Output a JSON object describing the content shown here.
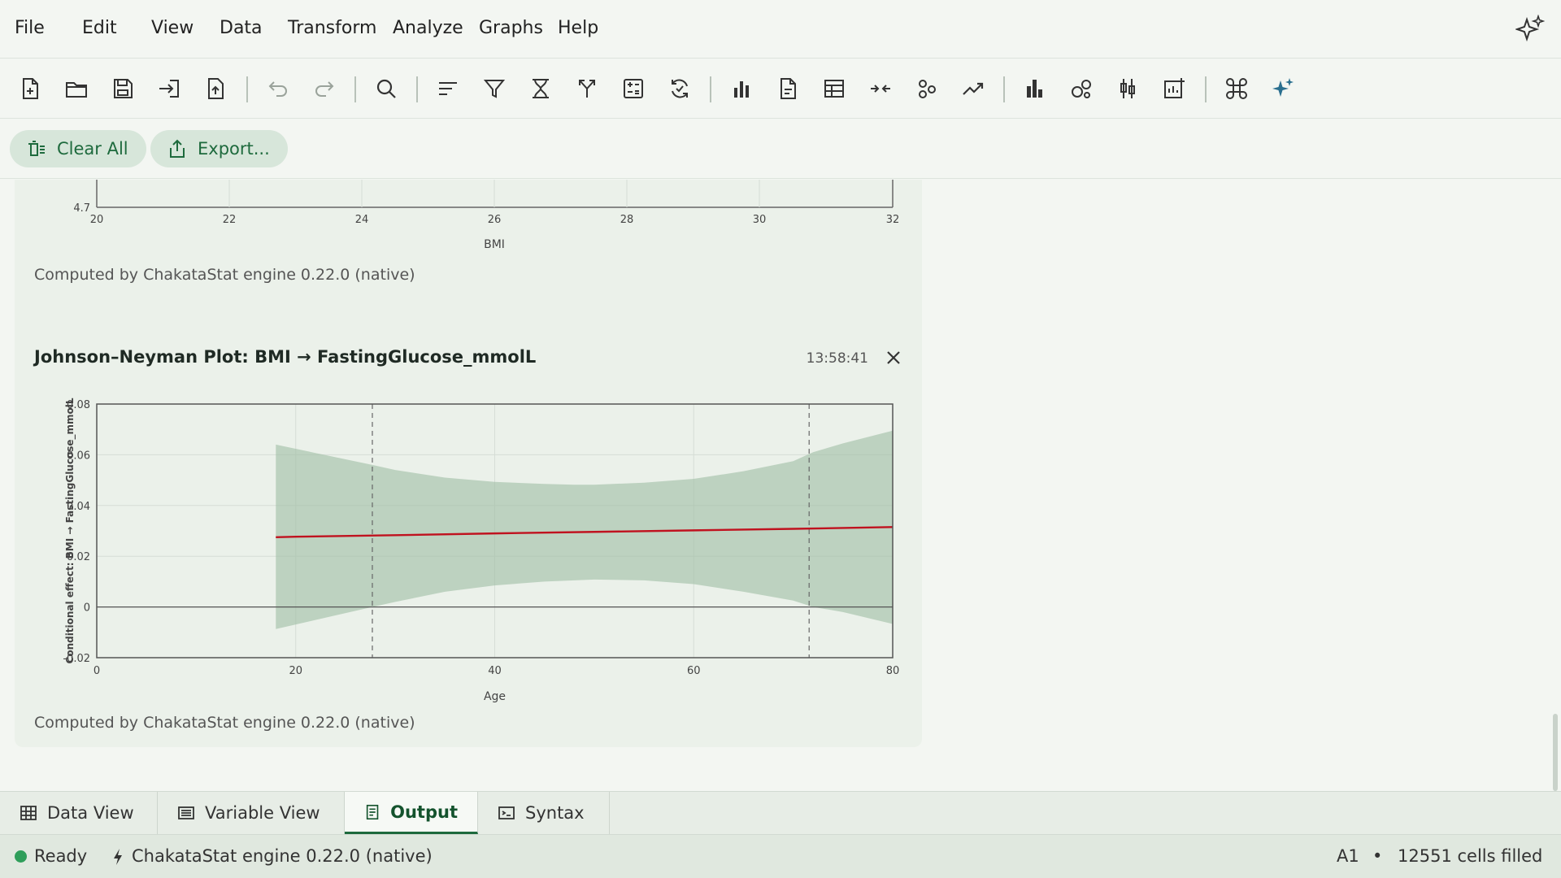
{
  "menu": {
    "items": [
      "File",
      "Edit",
      "View",
      "Data",
      "Transform",
      "Analyze",
      "Graphs",
      "Help"
    ]
  },
  "toolbar": {
    "icons": [
      "new-file-icon",
      "open-folder-icon",
      "save-icon",
      "import-icon",
      "export-file-icon",
      "undo-icon",
      "redo-icon",
      "search-icon",
      "sort-icon",
      "filter-icon",
      "select-cases-icon",
      "split-file-icon",
      "compute-icon",
      "recode-icon",
      "bar-chart-icon",
      "report-icon",
      "table-icon",
      "merge-icon",
      "scatter-icon",
      "trend-icon",
      "histogram-icon",
      "bubble-chart-icon",
      "boxplot-icon",
      "add-chart-icon",
      "command-icon",
      "ai-sparkle-icon"
    ]
  },
  "actions": {
    "clear_all": "Clear All",
    "export": "Export..."
  },
  "card1": {
    "y_tick": "4.7",
    "x_ticks": [
      "20",
      "22",
      "24",
      "26",
      "28",
      "30",
      "32"
    ],
    "x_label": "BMI",
    "footer": "Computed by ChakataStat engine 0.22.0 (native)"
  },
  "card2": {
    "title": "Johnson–Neyman Plot: BMI → FastingGlucose_mmolL",
    "timestamp": "13:58:41",
    "footer": "Computed by ChakataStat engine 0.22.0 (native)"
  },
  "chart_data": {
    "type": "line",
    "title": "Johnson–Neyman Plot: BMI → FastingGlucose_mmolL",
    "xlabel": "Age",
    "ylabel": "Conditional effect: BMI → FastingGlucose_mmolL",
    "xlim": [
      0,
      80
    ],
    "ylim": [
      -0.02,
      0.08
    ],
    "x_ticks": [
      0,
      20,
      40,
      60,
      80
    ],
    "y_ticks": [
      "-0.02",
      "0",
      "0.02",
      "0.04",
      "0.06",
      "0.08"
    ],
    "series": [
      {
        "x": [
          18,
          20,
          30,
          40,
          50,
          60,
          70,
          80
        ],
        "y": [
          0.0275,
          0.0277,
          0.0283,
          0.029,
          0.0296,
          0.0302,
          0.0308,
          0.0315
        ],
        "color": "#c0121f"
      }
    ],
    "confidence_band": {
      "x": [
        18,
        27.7,
        30,
        35,
        40,
        45,
        48,
        50,
        55,
        60,
        65,
        70,
        72,
        75,
        80
      ],
      "lower": [
        -0.0087,
        0.0,
        0.002,
        0.006,
        0.0085,
        0.01,
        0.0105,
        0.0108,
        0.0105,
        0.009,
        0.006,
        0.0025,
        0.0,
        -0.002,
        -0.0067
      ],
      "upper": [
        0.064,
        0.056,
        0.054,
        0.051,
        0.0493,
        0.0485,
        0.0482,
        0.0482,
        0.049,
        0.0505,
        0.0535,
        0.0575,
        0.061,
        0.0645,
        0.0695
      ],
      "color": "#9fbea3"
    },
    "reference_lines": {
      "vertical_x": [
        27.7,
        71.6
      ],
      "horizontal_y": [
        0
      ]
    },
    "grid": true
  },
  "tabs": [
    {
      "label": "Data View",
      "icon": "grid-icon",
      "active": false
    },
    {
      "label": "Variable View",
      "icon": "list-icon",
      "active": false
    },
    {
      "label": "Output",
      "icon": "document-icon",
      "active": true
    },
    {
      "label": "Syntax",
      "icon": "terminal-icon",
      "active": false
    }
  ],
  "status": {
    "state": "Ready",
    "engine": "ChakataStat engine 0.22.0 (native)",
    "cell": "A1",
    "separator": "•",
    "filled": "12551 cells filled"
  },
  "colors": {
    "accent": "#1e6a3d",
    "band": "#9fbea3",
    "line": "#c0121f",
    "background": "#f3f6f2"
  }
}
